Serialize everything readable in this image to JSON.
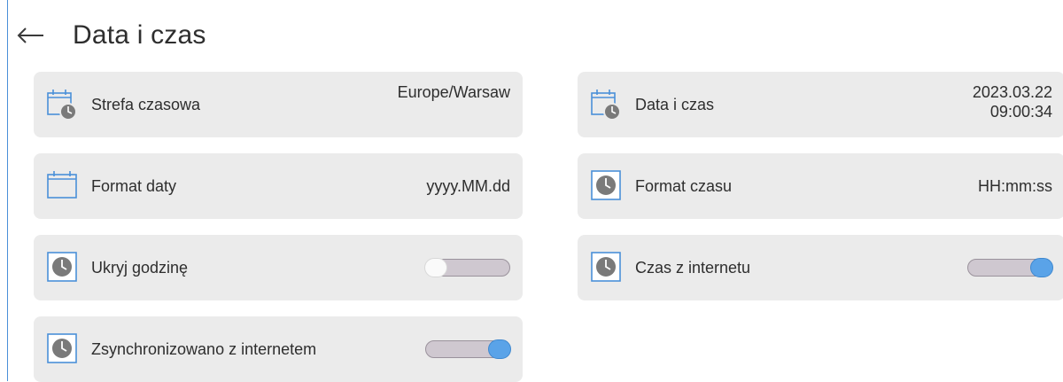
{
  "header": {
    "title": "Data i czas"
  },
  "settings": {
    "timezone": {
      "label": "Strefa czasowa",
      "value": "Europe/Warsaw",
      "icon": "calendar-clock-icon"
    },
    "datetime": {
      "label": "Data i czas",
      "date": "2023.03.22",
      "time": "09:00:34",
      "icon": "calendar-clock-icon"
    },
    "date_format": {
      "label": "Format daty",
      "value": "yyyy.MM.dd",
      "icon": "calendar-icon"
    },
    "time_format": {
      "label": "Format czasu",
      "value": "HH:mm:ss",
      "icon": "clock-icon"
    },
    "hide_hour": {
      "label": "Ukryj godzinę",
      "enabled": false,
      "icon": "clock-icon"
    },
    "internet_time": {
      "label": "Czas z internetu",
      "enabled": true,
      "icon": "clock-icon"
    },
    "synced": {
      "label": "Zsynchronizowano z internetem",
      "enabled": true,
      "icon": "clock-icon"
    }
  },
  "colors": {
    "accent": "#4a90d9",
    "toggle_on": "#5aa3e8",
    "card_bg": "#ebebeb"
  }
}
